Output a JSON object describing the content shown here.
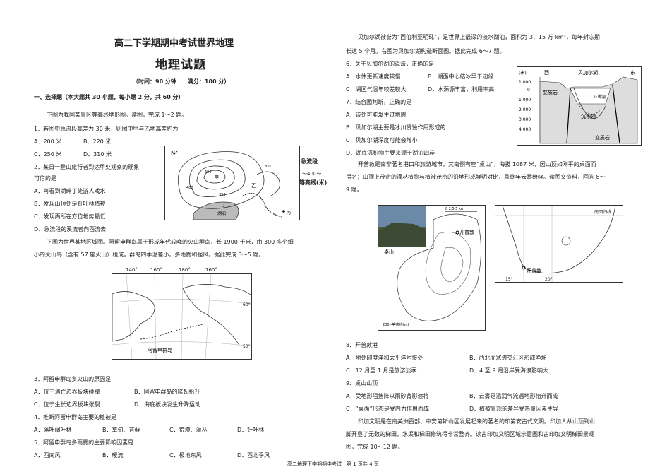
{
  "header": {
    "title": "高二下学期期中考试世界地理",
    "subtitle": "地理试题",
    "meta": "（时间：90 分钟　　满分：100 分）",
    "section1": "一、选择题（本大题共 30 小题，每小题 2 分，共 60 分）"
  },
  "left": {
    "intro1": "下图为我国某景区等高线地形图。读图，完成 1～2 题。",
    "q1": "1．若图中急流段高差为 30 米，则图中甲与乙地高差约为",
    "q1_opts": [
      "A．200 米",
      "B．220 米",
      "C．250 米",
      "D．310 米"
    ],
    "q2": "2．某日一登山旅行者到达甲处观察的现象",
    "q2b": "可信的是",
    "q2_opts": [
      "A．可看到湖畔丁处游人戏水",
      "B．发现山顶处是针叶林植被",
      "C．发现丙所在方位地势最低",
      "D．急流段的溪流者向西流去"
    ],
    "map1_labels": {
      "north": "N",
      "jia": "甲",
      "yi": "乙",
      "bing": "丙",
      "ding": "丁",
      "lake": "湖泊",
      "c600": "600",
      "c400": "400",
      "c350": "350",
      "c200": "200"
    },
    "legend": {
      "rapid": "急流段",
      "contour_value": "～400～",
      "contour": "等高线(米)"
    },
    "intro2_l1": "下图为世界某地区域图。阿留申群岛属于形成年代较晚的火山群岛，长 1900 千米，由 300 多个细",
    "intro2_l2": "小的火山岛（含有 57 座火山）组成。群岛四季温差小，多雨雾和强风。据此完成 3～5 题。",
    "map2_labels": {
      "lon": [
        "140°",
        "160°",
        "180°",
        "160°"
      ],
      "lat": [
        "60°",
        "50°"
      ],
      "chain": "阿留申群岛"
    },
    "q3": "3．阿留申群岛多火山的原因是",
    "q3_opts": [
      "A．位于消亡边界板块碰撞",
      "B．阿留申群岛的隆起抬升",
      "C．位于生长边界板块张裂",
      "D．海底板块发生升降运动"
    ],
    "q4": "4．推断阿留申群岛主要的植被是",
    "q4_opts": [
      "A．落叶阔叶林",
      "B．草甸、苔藓",
      "C．荒漠、灌丛",
      "D．针叶林"
    ],
    "q5": "5．阿留申群岛多雨雾的主要影响因素是",
    "q5_opts": [
      "A．西南风",
      "B．暖流",
      "C．极地东风",
      "D．西北季风"
    ]
  },
  "right": {
    "intro3_l1": "贝加尔湖被誉为“西伯利亚明珠”，是世界上最深的淡水湖泊，面积为 3．15 万 km²，每年封冻期",
    "intro3_l2": "长达 5 个月。右图为贝加尔湖构造断面图。据此完成 6～7 题。",
    "q6": "6．关于贝加尔湖的说法，正确的是",
    "q6_opts": [
      "A．水体更新速度较慢",
      "B．湖面中心结冰早于边缘",
      "C．湖区气温年较差较大",
      "D．水源源丰富，利用率高"
    ],
    "q7": "7．结合图判断，正确的是",
    "q7_opts": [
      "A．该处可能发生过地震",
      "B．贝加尔湖主要是冰川侵蚀作用形成的",
      "C．贝加尔湖深度可能会增小",
      "D．湖底沉积物主要来源于湖泊四岸"
    ],
    "section_fig": {
      "unit": "(米)",
      "west": "西",
      "lake": "贝加尔湖",
      "east": "东",
      "y": [
        "1 000",
        "0",
        "1 000",
        "2 000",
        "3 000",
        "4 000"
      ],
      "metamorphic": "变质岩",
      "zheng": "正断层",
      "sediment": "沉积物",
      "bottom": "变质岩"
    },
    "intro4_l1": "开普敦是南非著名港口和旅游城市，其南侧有座“桌山”，海拔 1087 米，因山顶如刚平的桌面而",
    "intro4_l2": "得名；山顶上茂密的灌丛植物与植被茂密的沿地形成鲜明对比，且终年云雾缭绕。读图文资料，回答 8～",
    "intro4_l3": "9 题。",
    "cape_fig": {
      "scale": "0 2.5 5 km",
      "town": "开普敦",
      "mountain": "桌山",
      "legend": "200~等高线(m)",
      "map_town": "开普敦",
      "tropic": "南回归线",
      "lon": "15°",
      "lon2": "20°"
    },
    "q8": "8、开普敦港",
    "q8_opts": [
      "A．地处印度洋和太平洋附接处",
      "B．西北面寒流交汇区形成渔场",
      "C．12 月至 1 月是旅游淡季",
      "D．4 至 9 月沿岸受海浪影响大"
    ],
    "q9": "9、桌山山顶",
    "q9_opts": [
      "A．受地形阻挡降以雨砂背影遮将",
      "B．云雾是温润气流遇地形抬升而成",
      "C．“桌面”形态是受内力作用而成",
      "D．植被景观的差异受热量因素主导"
    ],
    "intro5_l1": "印加文明是在南美洲西部、中安第斯山区发展起来的著名的印第安古代文明。印加人从山顶到山",
    "intro5_l2": "脚开垦了无数的梯田，水渠和梯田修筑得非常整齐。读古印加文明区域示意图和古印加文明梯田景观",
    "intro5_l3": "图，完成 10～12 题。"
  },
  "footer": "高二地理下学期期中考试　第 1 页共 4 页"
}
